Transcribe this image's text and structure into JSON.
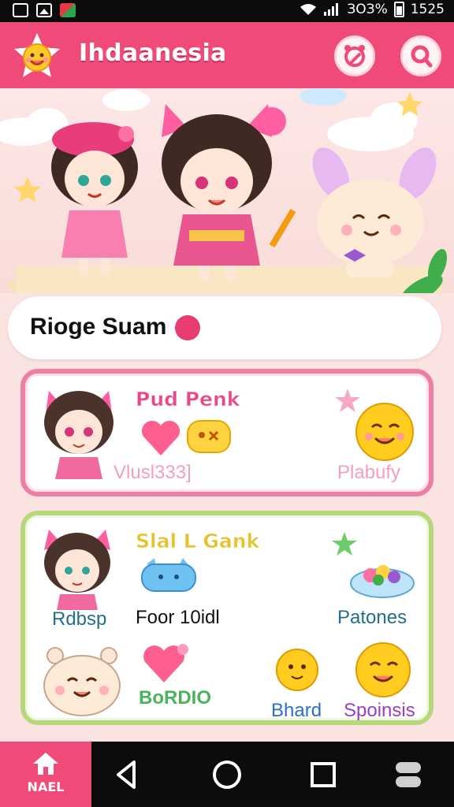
{
  "status_bar": {
    "battery_pct": "ЗОЗ%",
    "time": "1525"
  },
  "header": {
    "title": "Ihdaanesia"
  },
  "search": {
    "text": "Rioge Suam"
  },
  "cards": {
    "pink": {
      "title": "Pud Penk",
      "label_left": "Vlusl333]",
      "label_right": "Plabufy"
    },
    "green": {
      "title": "Slal L Gank",
      "label_row1_left": "Rdbsp",
      "label_row1_mid": "Foor 10idl",
      "label_row1_right": "Patones",
      "label_row2_mid": "BoRDIO",
      "label_row2_right1": "Bhard",
      "label_row2_right2": "Spoinsis"
    }
  },
  "nav": {
    "home_label": "NAEL"
  },
  "colors": {
    "accent": "#f04a78",
    "pink_border": "#ee7fa4",
    "green_border": "#b6d87a"
  }
}
